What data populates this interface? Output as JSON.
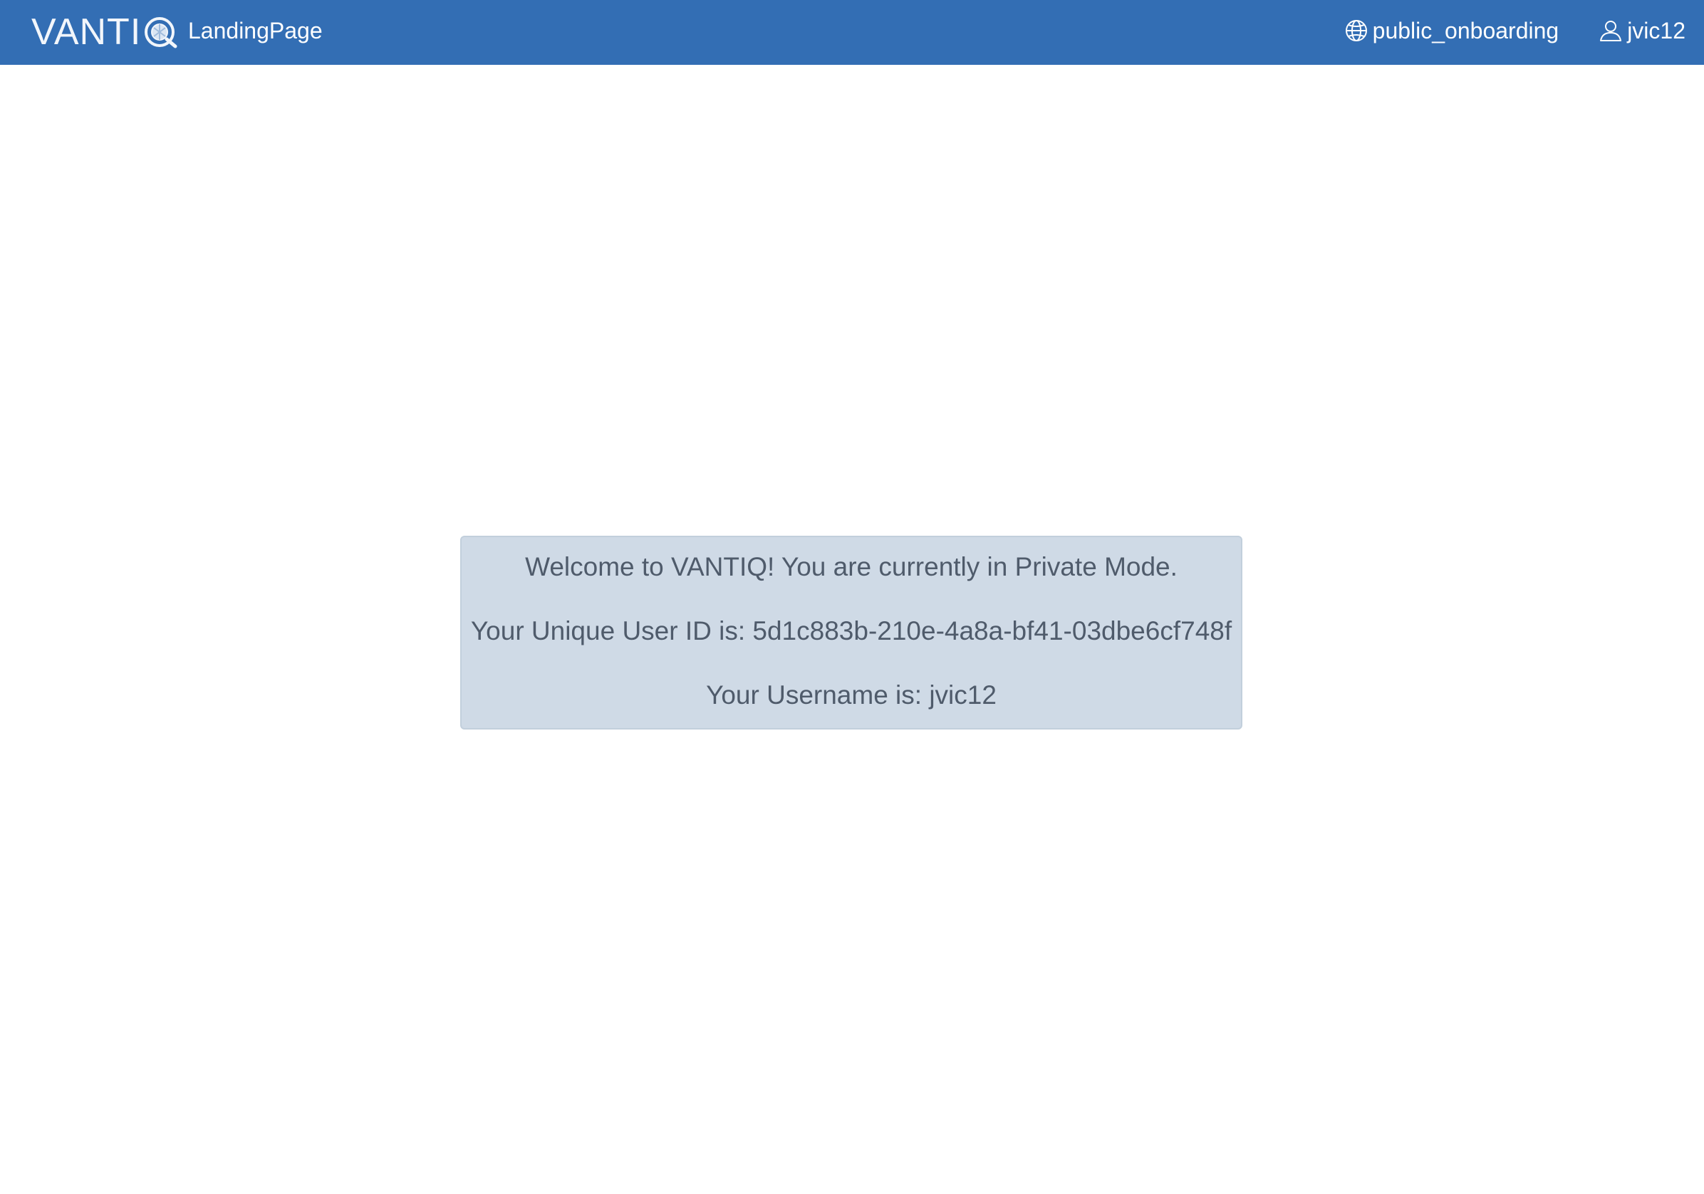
{
  "header": {
    "logo_text": "VANTI",
    "app_name": "LandingPage",
    "namespace": "public_onboarding",
    "username": "jvic12",
    "colors": {
      "bar": "#336eb4",
      "text": "#ffffff"
    },
    "icons": {
      "logo_mark": "vantiq-q-logo-icon",
      "namespace": "globe-icon",
      "user": "user-icon"
    }
  },
  "welcome": {
    "line1": "Welcome to VANTIQ! You are currently in Private Mode.",
    "line2": "Your Unique User ID is: 5d1c883b-210e-4a8a-bf41-03dbe6cf748f",
    "line3": "Your Username is: jvic12",
    "colors": {
      "background": "#cfdae6",
      "text": "#4f5b6b"
    }
  }
}
